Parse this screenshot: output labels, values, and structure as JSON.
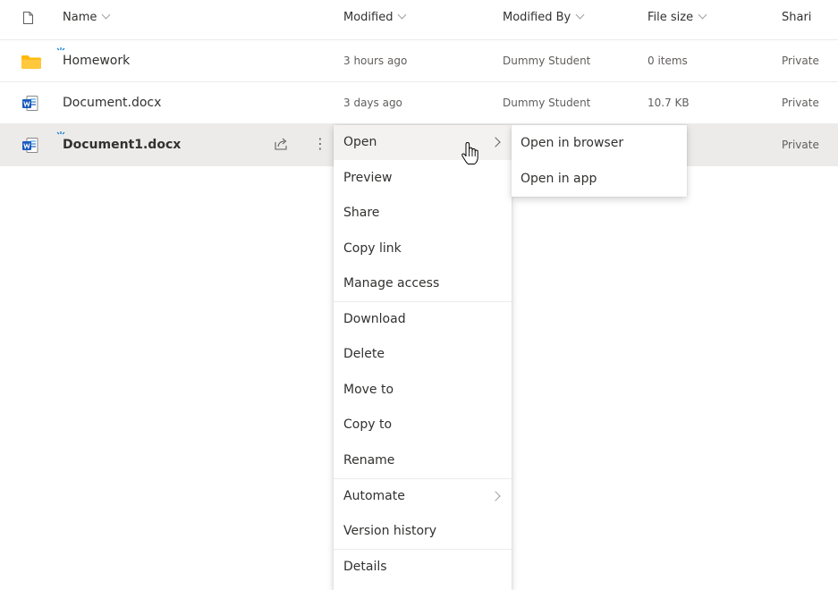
{
  "header": {
    "columns": {
      "name": "Name",
      "modified": "Modified",
      "modified_by": "Modified By",
      "file_size": "File size",
      "sharing": "Shari"
    },
    "type_icon": "document-outline-icon"
  },
  "rows": [
    {
      "icon": "folder-icon",
      "new": true,
      "name": "Homework",
      "modified": "3 hours ago",
      "modified_by": "Dummy Student",
      "size": "0 items",
      "sharing": "Private"
    },
    {
      "icon": "word-document-icon",
      "new": false,
      "name": "Document.docx",
      "modified": "3 days ago",
      "modified_by": "Dummy Student",
      "size": "10.7 KB",
      "sharing": "Private"
    },
    {
      "icon": "word-document-icon",
      "new": true,
      "selected": true,
      "name": "Document1.docx",
      "sharing": "Private"
    }
  ],
  "context_menu": {
    "items": [
      {
        "label": "Open",
        "submenu": true,
        "hovered": true
      },
      {
        "label": "Preview"
      },
      {
        "label": "Share"
      },
      {
        "label": "Copy link"
      },
      {
        "label": "Manage access"
      },
      {
        "label": "Download"
      },
      {
        "label": "Delete"
      },
      {
        "label": "Move to"
      },
      {
        "label": "Copy to"
      },
      {
        "label": "Rename"
      },
      {
        "label": "Automate",
        "submenu": true
      },
      {
        "label": "Version history"
      },
      {
        "label": "Details"
      }
    ]
  },
  "open_submenu": {
    "items": [
      {
        "label": "Open in browser"
      },
      {
        "label": "Open in app"
      }
    ]
  },
  "colors": {
    "selected_row": "#edebe9",
    "word_blue": "#185abd",
    "folder_yellow": "#ffb900",
    "new_indicator": "#0078d4"
  }
}
